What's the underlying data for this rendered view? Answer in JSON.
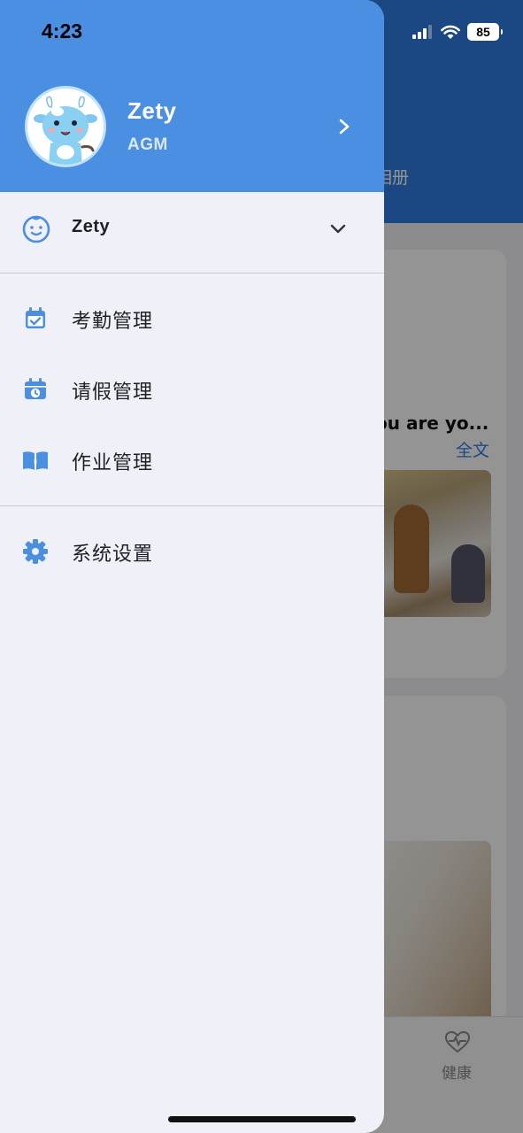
{
  "status_bar": {
    "time": "4:23",
    "battery": "85"
  },
  "drawer": {
    "profile": {
      "name": "Zety",
      "role": "AGM"
    },
    "account": {
      "name": "Zety"
    },
    "menu": [
      {
        "label": "考勤管理",
        "icon": "calendar-check-icon"
      },
      {
        "label": "请假管理",
        "icon": "calendar-clock-icon"
      },
      {
        "label": "作业管理",
        "icon": "open-book-icon"
      },
      {
        "label": "系统设置",
        "icon": "gear-icon"
      }
    ]
  },
  "background": {
    "tab_text": "相册",
    "card_title": "ou are yo...",
    "card_link": "全文",
    "tabbar_label": "健康"
  },
  "colors": {
    "drawer_header": "#4a8fe1",
    "accent_icon": "#4a8fe1",
    "drawer_bg": "#f0f1f8"
  }
}
